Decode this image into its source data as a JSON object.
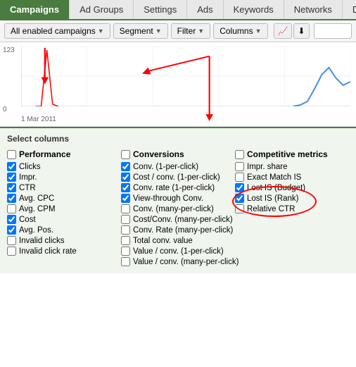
{
  "tabs": [
    {
      "label": "Campaigns",
      "active": true
    },
    {
      "label": "Ad Groups",
      "active": false
    },
    {
      "label": "Settings",
      "active": false
    },
    {
      "label": "Ads",
      "active": false
    },
    {
      "label": "Keywords",
      "active": false
    },
    {
      "label": "Networks",
      "active": false
    },
    {
      "label": "Di",
      "active": false
    }
  ],
  "toolbar": {
    "filter_label": "All enabled campaigns",
    "segment_label": "Segment",
    "filter_btn_label": "Filter",
    "columns_label": "Columns"
  },
  "chart": {
    "y_max": "123",
    "y_min": "0",
    "x_label": "1 Mar 2011"
  },
  "select_columns": {
    "title": "Select columns",
    "groups": [
      {
        "id": "performance",
        "header_checkbox": false,
        "header_label": "Performance",
        "items": [
          {
            "label": "Clicks",
            "checked": true
          },
          {
            "label": "Impr.",
            "checked": true
          },
          {
            "label": "CTR",
            "checked": true
          },
          {
            "label": "Avg. CPC",
            "checked": true
          },
          {
            "label": "Avg. CPM",
            "checked": false
          },
          {
            "label": "Cost",
            "checked": true
          },
          {
            "label": "Avg. Pos.",
            "checked": true
          },
          {
            "label": "Invalid clicks",
            "checked": false
          },
          {
            "label": "Invalid click rate",
            "checked": false
          }
        ]
      },
      {
        "id": "conversions",
        "header_checkbox": false,
        "header_label": "Conversions",
        "items": [
          {
            "label": "Conv. (1-per-click)",
            "checked": true
          },
          {
            "label": "Cost / conv. (1-per-click)",
            "checked": true
          },
          {
            "label": "Conv. rate (1-per-click)",
            "checked": true
          },
          {
            "label": "View-through Conv.",
            "checked": true
          },
          {
            "label": "Conv. (many-per-click)",
            "checked": false
          },
          {
            "label": "Cost/Conv. (many-per-click)",
            "checked": false
          },
          {
            "label": "Conv. Rate (many-per-click)",
            "checked": false
          },
          {
            "label": "Total conv. value",
            "checked": false
          },
          {
            "label": "Value / conv. (1-per-click)",
            "checked": false
          },
          {
            "label": "Value / conv. (many-per-click)",
            "checked": false
          }
        ]
      },
      {
        "id": "competitive",
        "header_checkbox": false,
        "header_label": "Competitive metrics",
        "items": [
          {
            "label": "Impr. share",
            "checked": false
          },
          {
            "label": "Exact Match IS",
            "checked": false
          },
          {
            "label": "Lost IS (Budget)",
            "checked": true,
            "highlighted": true
          },
          {
            "label": "Lost IS (Rank)",
            "checked": true,
            "highlighted": true
          },
          {
            "label": "Relative CTR",
            "checked": false
          }
        ]
      }
    ]
  }
}
